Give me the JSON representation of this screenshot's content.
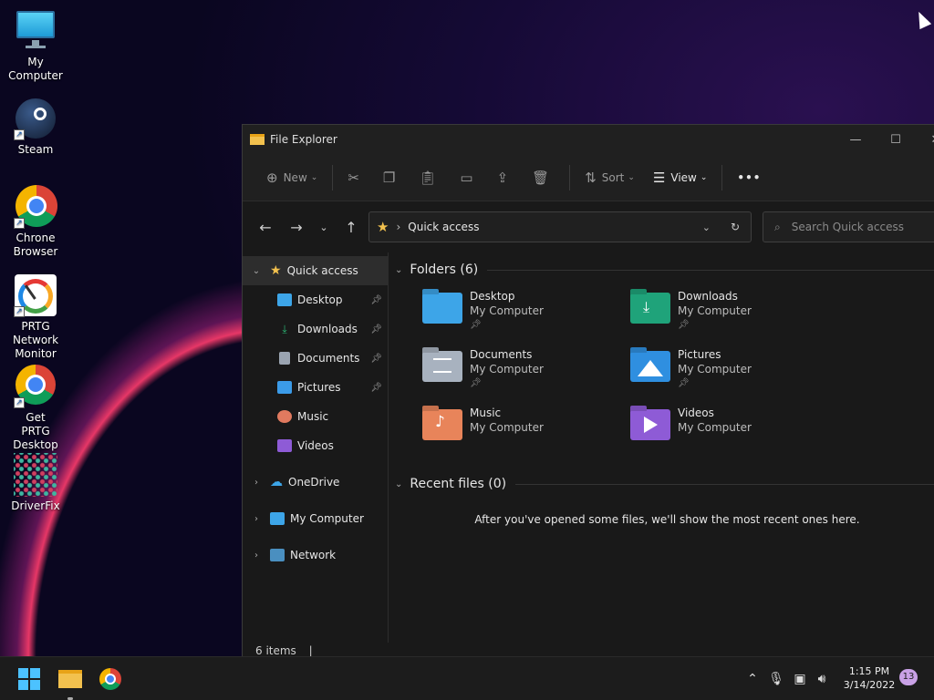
{
  "desktop": {
    "icons": [
      {
        "label": "My Computer"
      },
      {
        "label": "Steam"
      },
      {
        "label": "Chrone Browser"
      },
      {
        "label": "PRTG Network Monitor"
      },
      {
        "label": "Get PRTG Desktop"
      },
      {
        "label": "DriverFix"
      }
    ]
  },
  "window": {
    "title": "File Explorer",
    "toolbar": {
      "new_label": "New",
      "sort_label": "Sort",
      "view_label": "View",
      "more_label": "•••"
    },
    "address": {
      "path": "Quick access"
    },
    "search": {
      "placeholder": "Search Quick access"
    },
    "nav": {
      "quick_access": "Quick access",
      "pinned": [
        {
          "label": "Desktop",
          "color": "#3da5e8"
        },
        {
          "label": "Downloads",
          "color": "#2bb673"
        },
        {
          "label": "Documents",
          "color": "#9aa4b1"
        },
        {
          "label": "Pictures",
          "color": "#3b9be8"
        },
        {
          "label": "Music",
          "color": "#e07a5f"
        },
        {
          "label": "Videos",
          "color": "#8e5bd6"
        }
      ],
      "onedrive": "OneDrive",
      "my_computer": "My Computer",
      "network": "Network"
    },
    "folders_header": "Folders (6)",
    "folders": [
      {
        "name": "Desktop",
        "location": "My Computer",
        "pinned": true,
        "color": "#3da5e8"
      },
      {
        "name": "Downloads",
        "location": "My Computer",
        "pinned": true,
        "color": "#1fa37a"
      },
      {
        "name": "Documents",
        "location": "My Computer",
        "pinned": true,
        "color": "#a8b2bf"
      },
      {
        "name": "Pictures",
        "location": "My Computer",
        "pinned": true,
        "color": "#2f8fe0"
      },
      {
        "name": "Music",
        "location": "My Computer",
        "pinned": false,
        "color": "#e8845a"
      },
      {
        "name": "Videos",
        "location": "My Computer",
        "pinned": false,
        "color": "#8e5bd6"
      }
    ],
    "recent_header": "Recent files (0)",
    "recent_empty": "After you've opened some files, we'll show the most recent ones here.",
    "status": "6 items"
  },
  "taskbar": {
    "time": "1:15 PM",
    "date": "3/14/2022",
    "notifications": "13"
  }
}
